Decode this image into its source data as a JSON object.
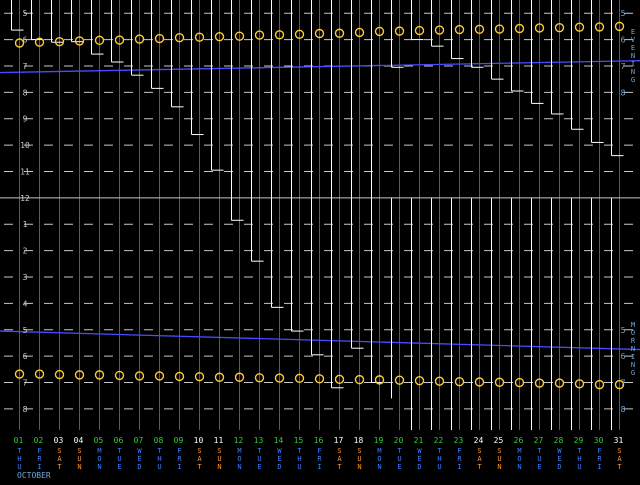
{
  "chart_data": {
    "type": "line",
    "month_label": "OCTOBER",
    "days": [
      "01",
      "02",
      "03",
      "04",
      "05",
      "06",
      "07",
      "08",
      "09",
      "10",
      "11",
      "12",
      "13",
      "14",
      "15",
      "16",
      "17",
      "18",
      "19",
      "20",
      "21",
      "22",
      "23",
      "24",
      "25",
      "26",
      "27",
      "28",
      "29",
      "30",
      "31"
    ],
    "weekdays": [
      "THU",
      "FRI",
      "SAT",
      "SUN",
      "MON",
      "TUE",
      "WED",
      "THU",
      "FRI",
      "SAT",
      "SUN",
      "MON",
      "TUE",
      "WED",
      "THU",
      "FRI",
      "SAT",
      "SUN",
      "MON",
      "TUE",
      "WED",
      "THU",
      "FRI",
      "SAT",
      "SUN",
      "MON",
      "TUE",
      "WED",
      "THU",
      "FRI",
      "SAT"
    ],
    "weekday_colors": {
      "weekday": "#3f7fff",
      "SAT": "#ff9933",
      "SUN": "#ff9933"
    },
    "day_number_colors": {
      "weekday": "#33cc33",
      "weekend": "#ffffff"
    },
    "upper_hour_labels": [
      "5",
      "6",
      "7",
      "8",
      "9",
      "10",
      "11",
      "12"
    ],
    "lower_hour_labels": [
      "1",
      "2",
      "3",
      "4",
      "5",
      "6",
      "7",
      "8"
    ],
    "right_upper_labels": [
      "5",
      "6",
      "7",
      "8"
    ],
    "right_lower_labels": [
      "5",
      "6",
      "7",
      "8"
    ],
    "evening_label": "EVENING",
    "morning_label": "MORNING",
    "hour_range": [
      16.5,
      32.8
    ],
    "twilight_evening": {
      "start": 19.25,
      "end": 18.8
    },
    "twilight_morning": {
      "start": 5.05,
      "end": 5.75
    },
    "sunset_hours": [
      18.13,
      18.1,
      18.08,
      18.05,
      18.03,
      18.02,
      17.98,
      17.96,
      17.93,
      17.91,
      17.89,
      17.87,
      17.83,
      17.82,
      17.8,
      17.77,
      17.76,
      17.73,
      17.69,
      17.68,
      17.66,
      17.64,
      17.62,
      17.61,
      17.6,
      17.58,
      17.56,
      17.55,
      17.53,
      17.52,
      17.5
    ],
    "sunrise_hours": [
      6.68,
      6.68,
      6.7,
      6.71,
      6.71,
      6.73,
      6.75,
      6.75,
      6.77,
      6.78,
      6.8,
      6.8,
      6.82,
      6.83,
      6.84,
      6.86,
      6.88,
      6.89,
      6.9,
      6.91,
      6.93,
      6.95,
      6.97,
      6.98,
      6.99,
      7.0,
      7.02,
      7.02,
      7.05,
      7.08,
      7.08
    ],
    "moonrise_hours": [
      17.64,
      18.0,
      18.1,
      18.08,
      18.55,
      18.85,
      19.35,
      19.85,
      20.55,
      21.6,
      22.95,
      24.85,
      26.4,
      28.15,
      29.05,
      29.95,
      31.2,
      29.7,
      31.0,
      19.05,
      18.0,
      18.25,
      18.72,
      19.05,
      19.5,
      19.95,
      20.42,
      20.82,
      21.4,
      21.9,
      22.4
    ],
    "moonset_hours": [
      null,
      18.0,
      18.1,
      18.15,
      18.55,
      18.85,
      19.35,
      20.0,
      20.6,
      21.6,
      22.95,
      24.85,
      26.4,
      28.15,
      29.05,
      29.95,
      null,
      null,
      null,
      31.6,
      33.9,
      34.9,
      36.4,
      37.45,
      38.3,
      39.3,
      40.2,
      41.2,
      41.6,
      43.2,
      43.9
    ],
    "colors": {
      "background": "#000000",
      "day_lines": "#cc2a2a",
      "grid": "#c8c8c8",
      "twilight": "#4a4aff",
      "moon": "#ffffff",
      "sun_markers": "#ffcc33",
      "labels": "#c8c8c8",
      "right_labels": "#6fa8dc"
    }
  }
}
